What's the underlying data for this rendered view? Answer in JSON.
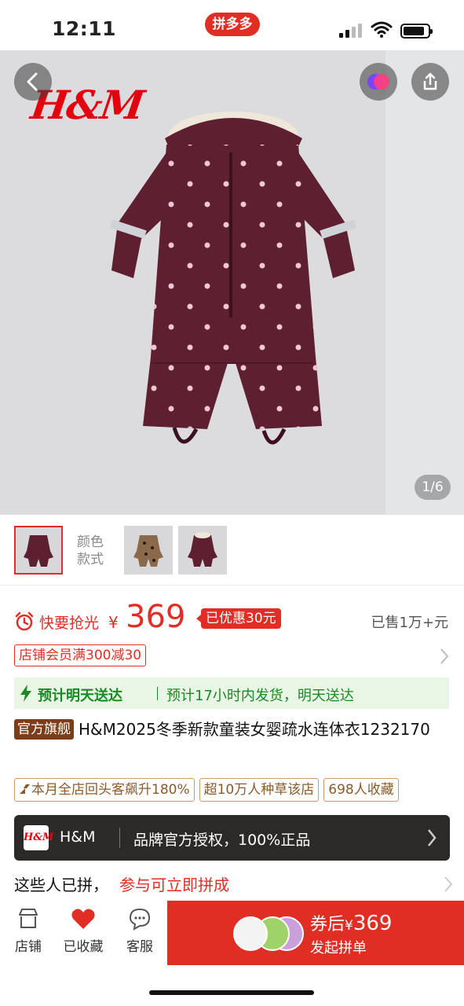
{
  "status_bar": {
    "time": "12:11",
    "app_badge": "拼多多"
  },
  "hero": {
    "brand_logo": "H&M",
    "page_indicator": "1/6"
  },
  "thumbnails": {
    "label": "颜色款式",
    "count": 3,
    "selected_index": 0
  },
  "price": {
    "flash_text": "快要抢光",
    "currency": "¥",
    "amount": "369",
    "discount": "已优惠30元",
    "sold": "已售1万+元"
  },
  "coupon": {
    "label": "店铺会员满300减30"
  },
  "shipping": {
    "main": "预计明天送达",
    "sub": "预计17小时内发货，明天送达"
  },
  "product": {
    "store_badge": "官方旗舰",
    "title": "H&M2025冬季新款童装女婴疏水连体衣1232170"
  },
  "tags": [
    "本月全店回头客飙升180%",
    "超10万人种草该店",
    "698人收藏"
  ],
  "brand_bar": {
    "logo": "H&M",
    "name": "H&M",
    "auth": "品牌官方授权，100%正品"
  },
  "group": {
    "text_a": "这些人已拼，",
    "text_b": "参与可立即拼成"
  },
  "bottom_nav": {
    "store_label": "店铺",
    "fav_label": "已收藏",
    "service_label": "客服",
    "buy_prefix": "券后",
    "buy_currency": "¥",
    "buy_price": "369",
    "buy_sub": "发起拼单"
  },
  "colors": {
    "accent": "#e02e24",
    "ship_green": "#1a8a24",
    "garment": "#5e2030"
  }
}
